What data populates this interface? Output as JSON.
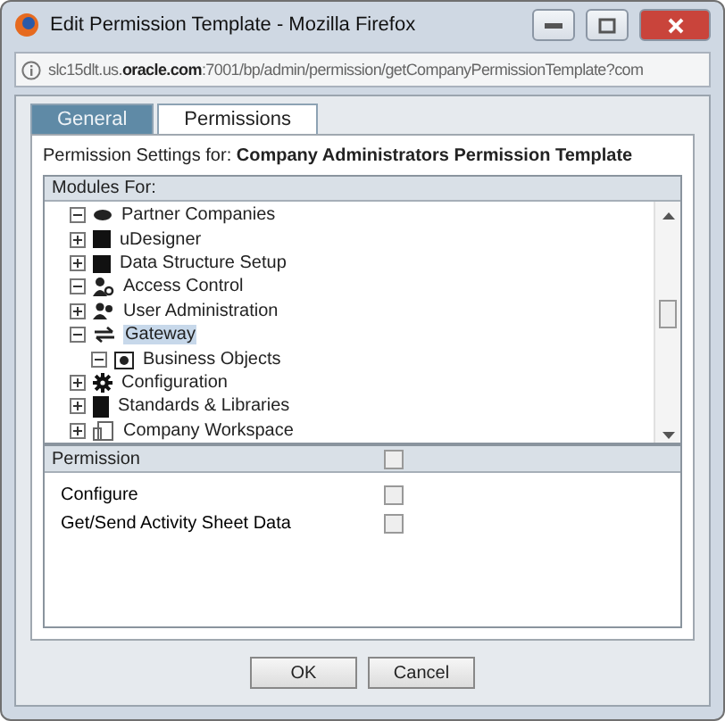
{
  "window": {
    "title": "Edit Permission Template - Mozilla Firefox"
  },
  "address_bar": {
    "host_pre": "slc15dlt.us.",
    "host_bold": "oracle.com",
    "rest": ":7001/bp/admin/permission/getCompanyPermissionTemplate?com"
  },
  "tabs": [
    {
      "label": "General",
      "selected": false
    },
    {
      "label": "Permissions",
      "selected": true
    }
  ],
  "settings_label": "Permission Settings for:",
  "template_name": "Company Administrators Permission Template",
  "modules": {
    "header": "Modules For:",
    "items": [
      {
        "label": "Partner Companies",
        "kind": "eye",
        "expanded": true,
        "selected": false
      },
      {
        "label": "uDesigner",
        "kind": "block",
        "expanded": false,
        "selected": false
      },
      {
        "label": "Data Structure Setup",
        "kind": "block",
        "expanded": false,
        "selected": false
      },
      {
        "label": "Access Control",
        "kind": "userkey",
        "expanded": true,
        "selected": false
      },
      {
        "label": "User Administration",
        "kind": "users",
        "expanded": false,
        "selected": false
      },
      {
        "label": "Gateway",
        "kind": "arrows",
        "expanded": true,
        "selected": true,
        "children": [
          {
            "label": "Business Objects",
            "kind": "camera",
            "expanded": true,
            "selected": false
          }
        ]
      },
      {
        "label": "Configuration",
        "kind": "gear",
        "expanded": false,
        "selected": false
      },
      {
        "label": "Standards & Libraries",
        "kind": "book",
        "expanded": false,
        "selected": false
      },
      {
        "label": "Company Workspace",
        "kind": "building",
        "expanded": false,
        "selected": false
      }
    ]
  },
  "permissions": {
    "header": "Permission",
    "header_checked": false,
    "rows": [
      {
        "label": "Configure",
        "checked": false
      },
      {
        "label": "Get/Send Activity Sheet Data",
        "checked": false
      }
    ]
  },
  "buttons": [
    "OK",
    "Cancel"
  ]
}
